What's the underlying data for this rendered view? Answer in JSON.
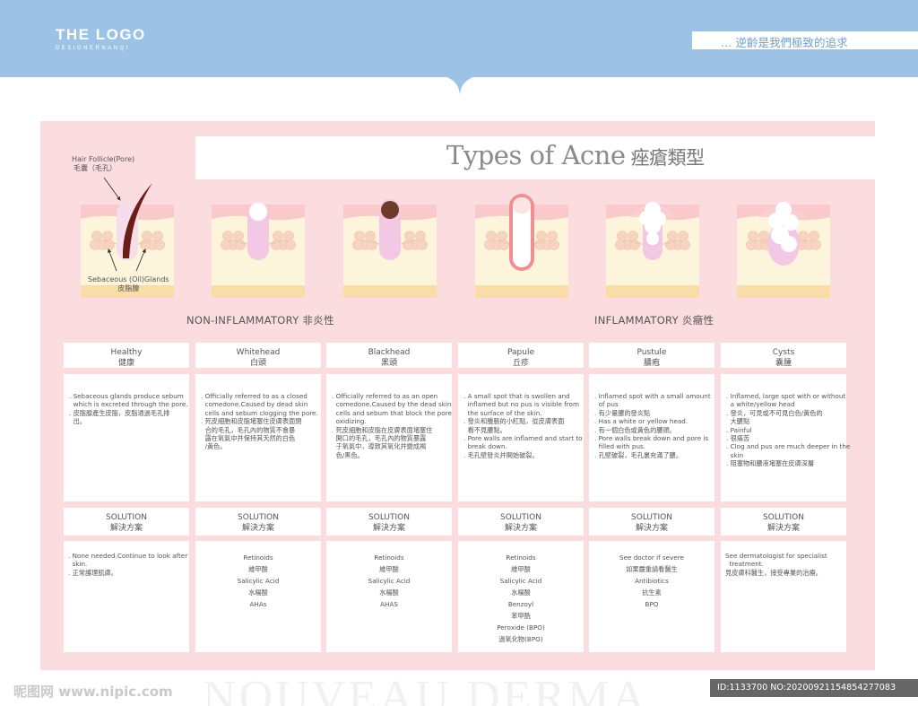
{
  "header": {
    "logo_main": "THE LOGO",
    "logo_sub": "DESIGNERNANQI",
    "slogan": "… 逆齡是我們極致的追求",
    "color": "#9cc3e5"
  },
  "title": {
    "en": "Types of Acne",
    "cn": "痤瘡類型"
  },
  "illustration_labels": {
    "follicle_en": "Hair Follicle(Pore)",
    "follicle_cn": "毛囊（毛孔）",
    "glands_en": "Sebaceous (Oil)Glands",
    "glands_cn": "皮脂腺"
  },
  "sections": {
    "non_inflammatory": "NON-INFLAMMATORY  非炎性",
    "inflammatory": "INFLAMMATORY  炎癥性"
  },
  "types": [
    {
      "en": "Healthy",
      "cn": "健康",
      "illustration": "healthy",
      "desc": [
        ". Sebaceous glands produce sebum",
        "  which is excreted through the pore.",
        ". 皮脂腺產生皮脂，皮脂通過毛孔排",
        "  出。"
      ],
      "solution_align": "left",
      "solution": [
        ". None needed.Continue to look after",
        "  skin.",
        ". 正常護理肌膚。"
      ]
    },
    {
      "en": "Whitehead",
      "cn": "白頭",
      "illustration": "whitehead",
      "desc": [
        ". Officially referred to as a closed",
        "  comedone.Caused by dead skin",
        "  cells and sebum clogging the pore.",
        ". 死皮細胞和皮脂堵塞住皮膚表面閉",
        "  合的毛孔，毛孔內的物質不會暴",
        "  露在氧氣中并保持其天然的白色",
        "  /黃色。"
      ],
      "solution_align": "center",
      "solution": [
        "Retinoids",
        "維甲酸",
        "Salicylic Acid",
        "水楊酸",
        "AHAs"
      ]
    },
    {
      "en": "Blackhead",
      "cn": "黑頭",
      "illustration": "blackhead",
      "desc": [
        ". Officially referred to as an open",
        "  comedone.Caused by the dead skin",
        "  cells and sebum that block the pore",
        "  oxidizing.",
        ". 死皮細胞和皮脂在皮膚表面堵塞住",
        "  開口的毛孔，毛孔內的物質暴露",
        "  于氧氣中，導致其氧化并變成褐",
        "  色/黑色。"
      ],
      "solution_align": "center",
      "solution": [
        "Retinoids",
        "維甲酸",
        "Salicylic Acid",
        "水楊酸",
        "AHAS"
      ]
    },
    {
      "en": "Papule",
      "cn": "丘疹",
      "illustration": "papule",
      "desc": [
        ". A small spot that is swollen and",
        "  inflamed but no pus is visible from",
        "  the surface of the skin.",
        ". 發炎和腫脹的小紅點，從皮膚表面",
        "  看不見膿點。",
        ". Pore walls are inflamed and start to",
        "  break down.",
        ". 毛孔壁發炎并開始破裂。"
      ],
      "solution_align": "center",
      "solution": [
        "Retinoids",
        "維甲酸",
        "Salicylic Acid",
        "水楊酸",
        "Benzoyl",
        "苯甲酰",
        "Peroxide (BPO)",
        "過氧化物(BPO)"
      ]
    },
    {
      "en": "Pustule",
      "cn": "膿疱",
      "illustration": "pustule",
      "desc": [
        ". Inflamed spot with a small amount",
        "  of pus",
        ". 有少量膿的發炎點",
        ". Has a white or yellow head.",
        ". 有一個白色或黃色的膿頭。",
        ". Pore walls break down and pore is",
        "  filled with pus.",
        ". 孔壁破裂，毛孔裏充滿了膿。"
      ],
      "solution_align": "center",
      "solution": [
        "See doctor if severe",
        "如果嚴重請看醫生",
        "Antibiotics",
        "抗生素",
        "BPO"
      ]
    },
    {
      "en": "Cysts",
      "cn": "囊腫",
      "illustration": "cyst",
      "desc": [
        ". Inflamed, large spot with or without",
        "  a white/yellow head",
        ". 發炎，可見或不可見白色/黃色的",
        "  大膿點",
        ". Painful",
        ". 很痛苦",
        ". Clog and pus are much deeper in the",
        "  skin",
        ". 阻塞物和膿液堵塞在皮膚深層"
      ],
      "solution_align": "left",
      "solution": [
        "See dermatologist for specialist",
        "  treatment.",
        "見皮膚科醫生，接受專業的治療。"
      ]
    }
  ],
  "solution_heading": {
    "en": "SOLUTION",
    "cn": "解決方案"
  },
  "footer": {
    "watermark": "NOUVEAU DERMA",
    "site": "昵图网 www.nipic.com",
    "id": "ID:1133700 NO:20200921154854277083"
  },
  "colors": {
    "panel": "#fbdde0",
    "skin_top": "#f9c9cc",
    "tissue": "#fdf4dc",
    "fat": "#f9dca6",
    "gland": "#f7d4c0",
    "hair": "#6b1e16",
    "inflamed": "#f08f8f"
  }
}
